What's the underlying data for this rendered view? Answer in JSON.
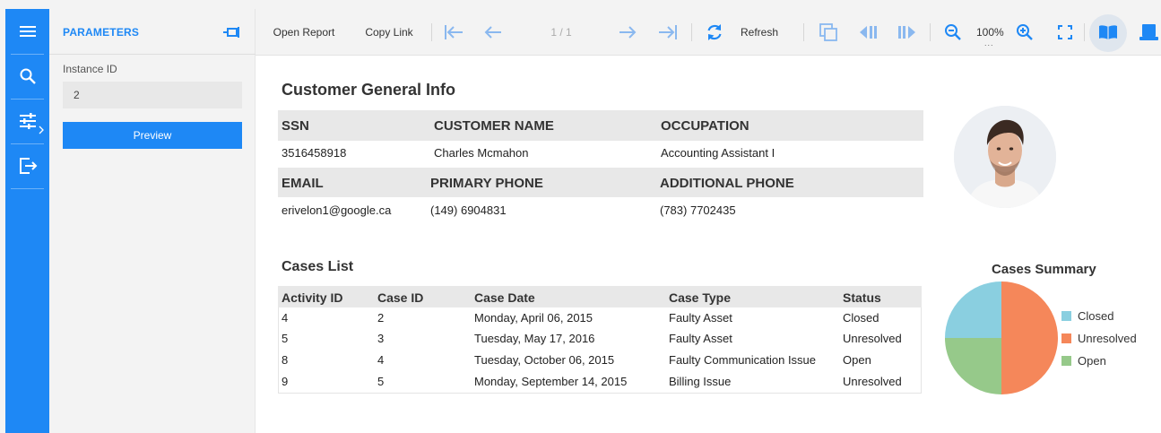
{
  "params": {
    "title": "PARAMETERS",
    "instance_label": "Instance ID",
    "instance_value": "2",
    "preview_label": "Preview"
  },
  "toolbar": {
    "open_report": "Open Report",
    "copy_link": "Copy Link",
    "page_indicator": "1 / 1",
    "refresh": "Refresh",
    "zoom": "100%",
    "zoom_dots": "..."
  },
  "customer": {
    "title": "Customer General Info",
    "headers1": [
      "SSN",
      "CUSTOMER NAME",
      "OCCUPATION"
    ],
    "values1": [
      "3516458918",
      "Charles Mcmahon",
      "Accounting Assistant I"
    ],
    "headers2": [
      "EMAIL",
      "PRIMARY PHONE",
      "ADDITIONAL PHONE"
    ],
    "values2": [
      "erivelon1@google.ca",
      "(149) 6904831",
      "(783) 7702435"
    ]
  },
  "cases": {
    "title": "Cases List",
    "headers": [
      "Activity ID",
      "Case ID",
      "Case Date",
      "Case Type",
      "Status"
    ],
    "rows": [
      [
        "4",
        "2",
        "Monday, April 06, 2015",
        "Faulty Asset",
        "Closed"
      ],
      [
        "5",
        "3",
        "Tuesday, May 17, 2016",
        "Faulty Asset",
        "Unresolved"
      ],
      [
        "8",
        "4",
        "Tuesday, October 06, 2015",
        "Faulty Communication Issue",
        "Open"
      ],
      [
        "9",
        "5",
        "Monday, September 14, 2015",
        "Billing Issue",
        "Unresolved"
      ]
    ]
  },
  "summary": {
    "title": "Cases Summary",
    "legend": [
      {
        "label": "Closed",
        "color": "#8acfe0"
      },
      {
        "label": "Unresolved",
        "color": "#f5875a"
      },
      {
        "label": "Open",
        "color": "#96c98a"
      }
    ],
    "pie": [
      {
        "label": "Closed",
        "value": 1,
        "color": "#8acfe0"
      },
      {
        "label": "Unresolved",
        "value": 2,
        "color": "#f5875a"
      },
      {
        "label": "Open",
        "value": 1,
        "color": "#96c98a"
      }
    ]
  },
  "colors": {
    "accent": "#1e88f5",
    "header_bar": "#e8e8e8"
  }
}
